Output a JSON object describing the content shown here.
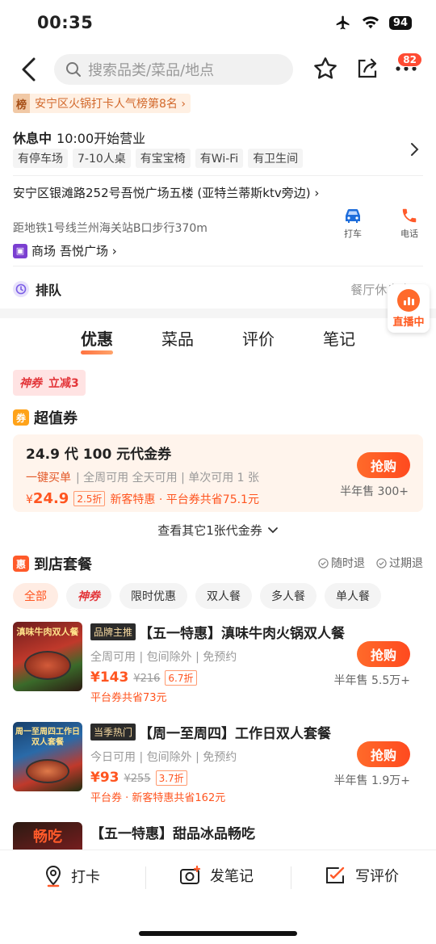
{
  "status": {
    "time": "00:35",
    "battery": "94"
  },
  "nav": {
    "search_placeholder": "搜索品类/菜品/地点",
    "badge": "82"
  },
  "rank": {
    "icon": "榜",
    "text": "安宁区火锅打卡人气榜第8名 ›"
  },
  "hours": {
    "state": "休息中",
    "open": "10:00开始营业"
  },
  "facilities": [
    "有停车场",
    "7-10人桌",
    "有宝宝椅",
    "有Wi-Fi",
    "有卫生间"
  ],
  "address": {
    "line": "安宁区银滩路252号吾悦广场五楼 (亚特兰蒂斯ktv旁边) ›",
    "distance": "距地铁1号线兰州海关站B口步行370m",
    "mall_label": "商场",
    "mall_name": "吾悦广场 ›",
    "taxi": "打车",
    "phone": "电话"
  },
  "queue": {
    "label": "排队",
    "status": "餐厅休息中 ›"
  },
  "live": {
    "label": "直播中"
  },
  "tabs": [
    "优惠",
    "菜品",
    "评价",
    "笔记"
  ],
  "shenquan": {
    "label": "神券",
    "offer": "立减3"
  },
  "voucher_section": {
    "icon": "券",
    "title": "超值券",
    "card": {
      "title": "24.9 代 100 元代金券",
      "tag_hl": "一键买单",
      "tags": "| 全周可用 全天可用 | 单次可用 1 张",
      "price_symbol": "¥",
      "price": "24.9",
      "discount": "2.5折",
      "saving": "新客特惠 · 平台券共省75.1元",
      "button": "抢购",
      "sold": "半年售 300+"
    },
    "more": "查看其它1张代金券"
  },
  "set_section": {
    "icon": "惠",
    "title": "到店套餐",
    "opt1": "随时退",
    "opt2": "过期退",
    "filters": [
      "全部",
      "神券",
      "限时优惠",
      "双人餐",
      "多人餐",
      "单人餐"
    ]
  },
  "deals": [
    {
      "tag": "品牌主推",
      "title": "【五一特惠】滇味牛肉火锅双人餐",
      "sub": "全周可用 | 包间除外 | 免预约",
      "price": "¥143",
      "orig": "¥216",
      "discount": "6.7折",
      "save": "平台券共省73元",
      "button": "抢购",
      "sold": "半年售 5.5万+",
      "img_text": "滇味牛肉双人餐"
    },
    {
      "tag": "当季热门",
      "title": "【周一至周四】工作日双人套餐",
      "sub": "今日可用 | 包间除外 | 免预约",
      "price": "¥93",
      "orig": "¥255",
      "discount": "3.7折",
      "save": "平台券 · 新客特惠共省162元",
      "button": "抢购",
      "sold": "半年售 1.9万+",
      "img_text": "周一至周四工作日双人套餐"
    },
    {
      "tag": "",
      "title": "【五一特惠】甜品冰品畅吃",
      "img_text": "畅吃"
    }
  ],
  "bottom": {
    "checkin": "打卡",
    "post": "发笔记",
    "review": "写评价"
  },
  "colors": {
    "accent": "#ff5520",
    "brand_gradient": "#ff6a2a"
  }
}
